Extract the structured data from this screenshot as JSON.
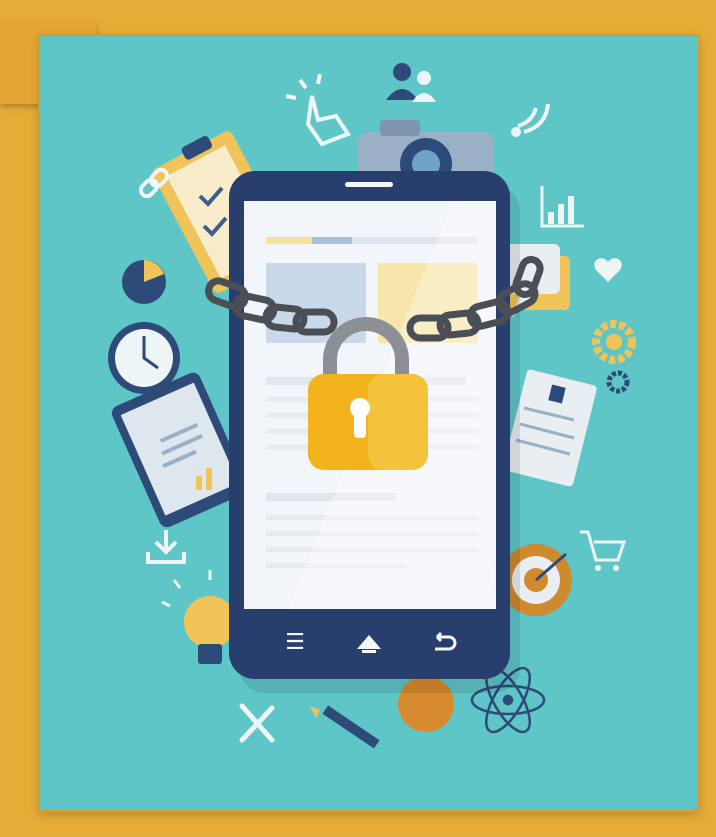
{
  "colors": {
    "frame": "#e6ac37",
    "background": "#5fc6c8",
    "phone_body": "#283f6e",
    "screen": "#f2f5f9",
    "padlock": "#f2b31c",
    "chain": "#4a4f55"
  },
  "phone": {
    "nav_buttons": [
      {
        "name": "menu-icon",
        "glyph": "☰"
      },
      {
        "name": "home-icon",
        "glyph": "⌂"
      },
      {
        "name": "back-icon",
        "glyph": "↩"
      }
    ]
  },
  "icons": [
    "hand-pointer-icon",
    "users-icon",
    "camera-icon",
    "wifi-signal-icon",
    "link-icon",
    "clipboard-checklist-icon",
    "bar-chart-icon",
    "pie-chart-icon",
    "heart-icon",
    "clock-icon",
    "gear-icon",
    "chat-bubble-icon",
    "tablet-icon",
    "envelope-icon",
    "download-icon",
    "shopping-cart-icon",
    "lightbulb-icon",
    "target-icon",
    "apple-icon",
    "atom-icon",
    "wrench-screwdriver-icon",
    "pencil-icon",
    "padlock-icon",
    "chain-icon"
  ]
}
